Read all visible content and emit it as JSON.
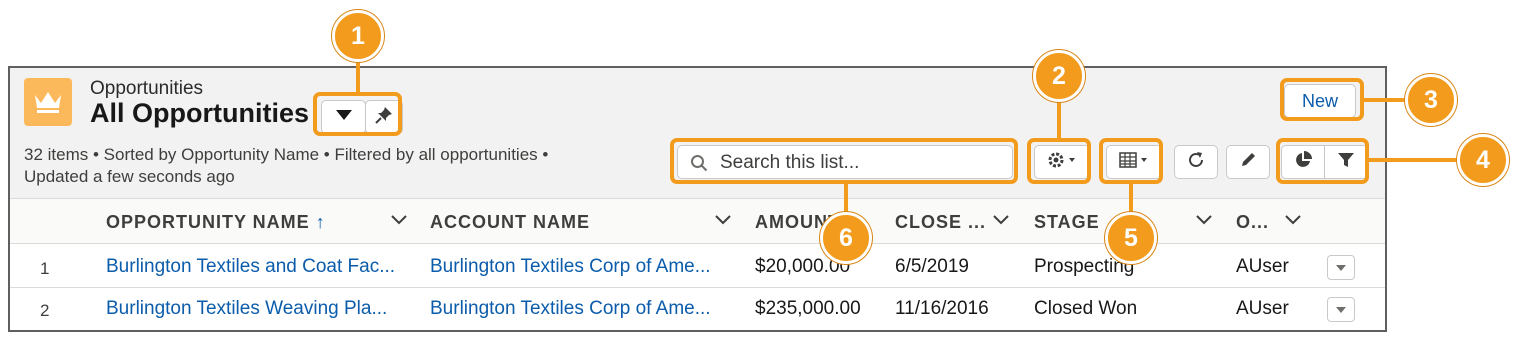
{
  "header": {
    "object_label": "Opportunities",
    "list_title": "All Opportunities",
    "meta_line1": "32 items • Sorted by Opportunity Name • Filtered by all opportunities •",
    "meta_line2": "Updated a few seconds ago"
  },
  "search": {
    "placeholder": "Search this list..."
  },
  "actions": {
    "new_label": "New"
  },
  "icons": {
    "app": "crown-icon",
    "title_toggle": "caret-down-icon",
    "pin": "pin-icon",
    "search": "search-icon",
    "settings": "gear-icon",
    "display_as": "table-icon",
    "refresh": "refresh-icon",
    "edit": "pencil-icon",
    "charts": "pie-chart-icon",
    "filters": "filter-icon",
    "column_menu": "chevron-down-icon",
    "row_menu": "caret-down-icon"
  },
  "table": {
    "columns": [
      {
        "label": "OPPORTUNITY NAME",
        "sort": "↑"
      },
      {
        "label": "ACCOUNT NAME"
      },
      {
        "label": "AMOUNT"
      },
      {
        "label": "CLOSE ..."
      },
      {
        "label": "STAGE"
      },
      {
        "label": "O..."
      }
    ],
    "rows": [
      {
        "num": "1",
        "name": "Burlington Textiles and Coat Fac...",
        "account": "Burlington Textiles Corp of Ame...",
        "amount": "$20,000.00",
        "close": "6/5/2019",
        "stage": "Prospecting",
        "owner": "AUser"
      },
      {
        "num": "2",
        "name": "Burlington Textiles Weaving Pla...",
        "account": "Burlington Textiles Corp of Ame...",
        "amount": "$235,000.00",
        "close": "11/16/2016",
        "stage": "Closed Won",
        "owner": "AUser"
      }
    ]
  },
  "callouts": [
    "1",
    "2",
    "3",
    "4",
    "5",
    "6"
  ],
  "colors": {
    "callout": "#f29b1d",
    "app_icon": "#fcb95b",
    "link": "#0b5cab",
    "header_bg": "#f3f2f2"
  }
}
